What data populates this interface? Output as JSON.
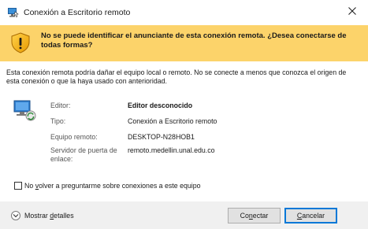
{
  "window": {
    "title": "Conexión a Escritorio remoto"
  },
  "warning": {
    "message": "No se puede identificar el anunciante de esta conexión remota. ¿Desea conectarse de todas formas?"
  },
  "description": "Esta conexión remota podría dañar el equipo local o remoto. No se conecte a menos que conozca el origen de esta conexión o que la haya usado con anterioridad.",
  "details": [
    {
      "label": "Editor:",
      "value": "Editor desconocido",
      "bold": true
    },
    {
      "label": "Tipo:",
      "value": "Conexión a Escritorio remoto",
      "bold": false
    },
    {
      "label": "Equipo remoto:",
      "value": "DESKTOP-N28HOB1",
      "bold": false
    },
    {
      "label": "Servidor de puerta de enlace:",
      "value": "remoto.medellin.unal.edu.co",
      "bold": false
    }
  ],
  "checkbox": {
    "label_pre": "No ",
    "label_u": "v",
    "label_post": "olver a preguntarme sobre conexiones a este equipo",
    "checked": false
  },
  "footer": {
    "details_pre": "Mostrar ",
    "details_u": "d",
    "details_post": "etalles",
    "connect_pre": "Co",
    "connect_u": "n",
    "connect_post": "ectar",
    "cancel_pre": "",
    "cancel_u": "C",
    "cancel_post": "ancelar"
  },
  "colors": {
    "warning_banner": "#fcd36a",
    "footer_bg": "#f0f0f0",
    "focus_border": "#0078d7"
  },
  "icons": {
    "app": "remote-desktop-icon",
    "warning": "shield-warning-icon",
    "computer": "computer-icon",
    "close": "close-icon",
    "expand": "chevron-down-icon"
  }
}
